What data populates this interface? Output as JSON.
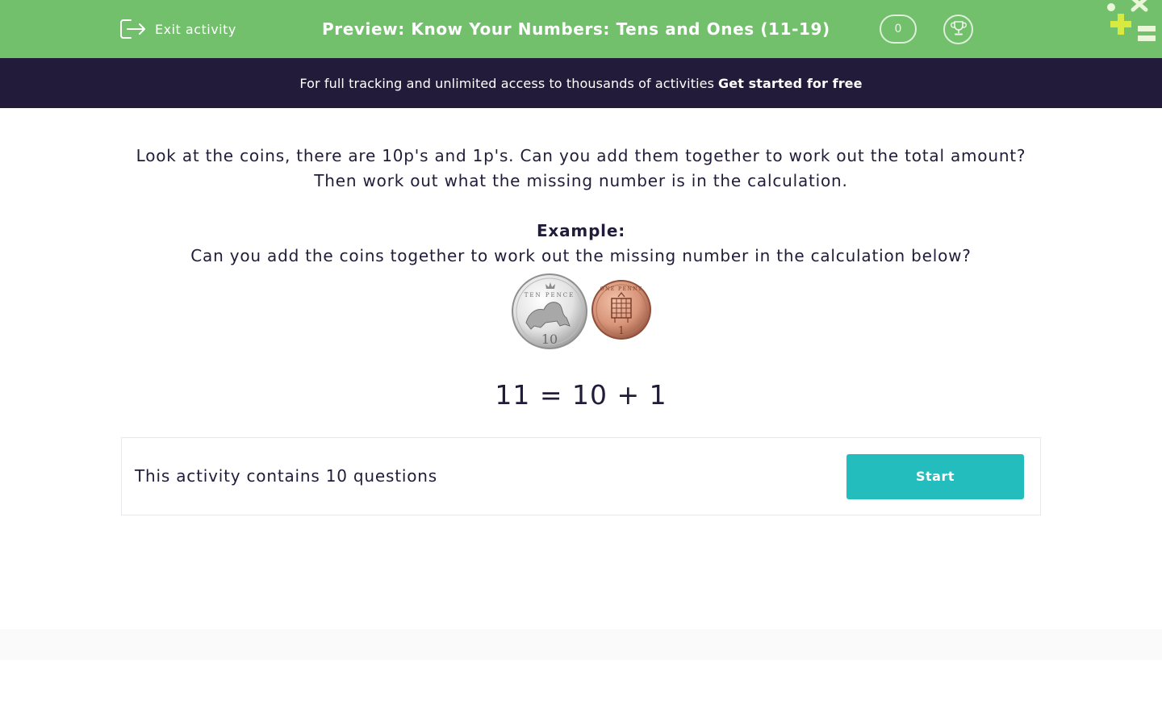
{
  "header": {
    "exit_label": "Exit activity",
    "title": "Preview: Know Your Numbers: Tens and Ones (11-19)",
    "score": "0",
    "exit_icon": "exit-icon",
    "trophy_icon": "trophy-icon",
    "background_color": "#72c06b"
  },
  "promo": {
    "text": "For full tracking and unlimited access to thousands of activities",
    "cta": "Get started for free",
    "background_color": "#231b3a"
  },
  "main": {
    "instructions": "Look at the coins, there are 10p's and 1p's. Can you add them together to work out the total amount? Then work out what the missing number is in the calculation.",
    "example_label": "Example:",
    "example_question": "Can you add the coins together to work out the missing number in the calculation below?",
    "coins": [
      {
        "name": "ten-pence-coin",
        "text": "TEN PENCE",
        "value": "10"
      },
      {
        "name": "one-penny-coin",
        "text": "ONE PENNY",
        "value": "1"
      }
    ],
    "equation": "11 = 10 + 1"
  },
  "start_card": {
    "question_count_text": "This activity contains 10 questions",
    "start_label": "Start",
    "accent_color": "#24bdbd"
  }
}
